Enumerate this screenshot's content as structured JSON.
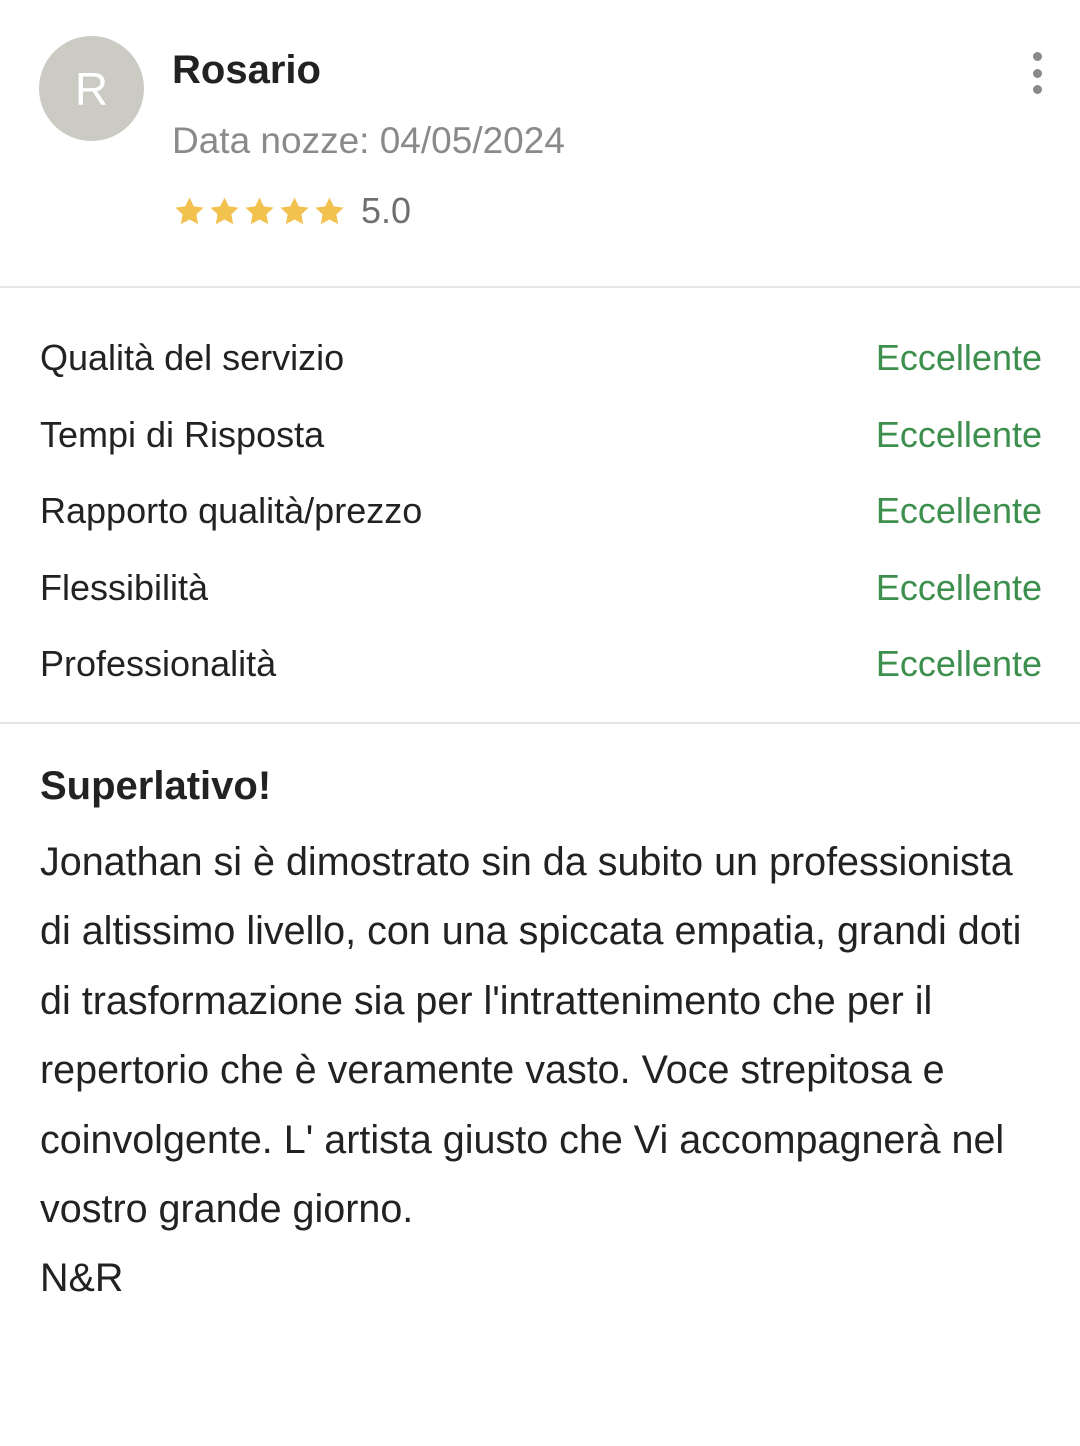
{
  "reviewer": {
    "initial": "R",
    "name": "Rosario",
    "wedding_date": "Data nozze: 04/05/2024",
    "rating": 5.0,
    "rating_label": "5.0",
    "star_color": "#f2c14e",
    "stars": [
      "star-icon",
      "star-icon",
      "star-icon",
      "star-icon",
      "star-icon"
    ]
  },
  "menu": {
    "icon": "more-vertical-icon"
  },
  "scores": [
    {
      "label": "Qualità del servizio",
      "value": "Eccellente"
    },
    {
      "label": "Tempi di Risposta",
      "value": "Eccellente"
    },
    {
      "label": "Rapporto qualità/prezzo",
      "value": "Eccellente"
    },
    {
      "label": "Flessibilità",
      "value": "Eccellente"
    },
    {
      "label": "Professionalità",
      "value": "Eccellente"
    }
  ],
  "review": {
    "title": "Superlativo!",
    "body": "Jonathan si è dimostrato sin da subito un professionista di altissimo livello, con una spiccata empatia, grandi doti di trasformazione sia per l'intrattenimento che per il repertorio che è veramente vasto. Voce strepitosa e coinvolgente. L' artista giusto che Vi accompagnerà nel vostro grande giorno.\nN&R"
  },
  "colors": {
    "accent_green": "#3d8f4d",
    "avatar_bg": "#cbcbc3",
    "muted_text": "#8a8a8a"
  }
}
